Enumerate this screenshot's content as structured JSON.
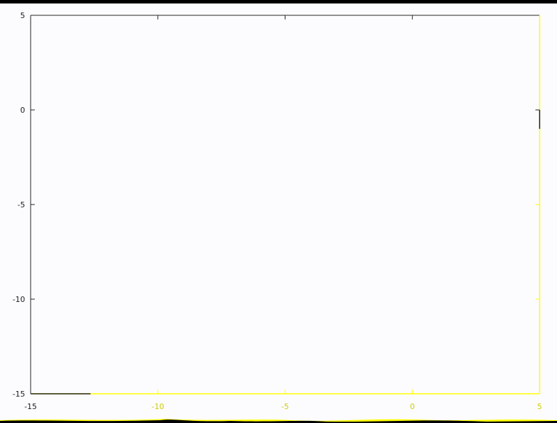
{
  "chart_data": {
    "type": "line",
    "title": "",
    "xlabel": "",
    "ylabel": "",
    "xlim": [
      -15,
      5
    ],
    "ylim": [
      -15,
      5
    ],
    "x_ticks": [
      {
        "value": -15,
        "label": "-15"
      },
      {
        "value": -10,
        "label": "-10"
      },
      {
        "value": -5,
        "label": "-5"
      },
      {
        "value": 0,
        "label": "0"
      },
      {
        "value": 5,
        "label": "5"
      }
    ],
    "y_ticks": [
      {
        "value": 5,
        "label": "5"
      },
      {
        "value": 0,
        "label": "0"
      },
      {
        "value": -5,
        "label": "-5"
      },
      {
        "value": -10,
        "label": "-10"
      },
      {
        "value": -15,
        "label": "-15"
      }
    ],
    "grid": false,
    "legend": "none",
    "series": []
  },
  "colors": {
    "background": "#fcfcff",
    "frame_dark": "#222222",
    "frame_highlight": "#ffff00",
    "label_dark": "#1a1a1a",
    "label_highlight": "#cccc00",
    "top_bar": "#000000"
  }
}
